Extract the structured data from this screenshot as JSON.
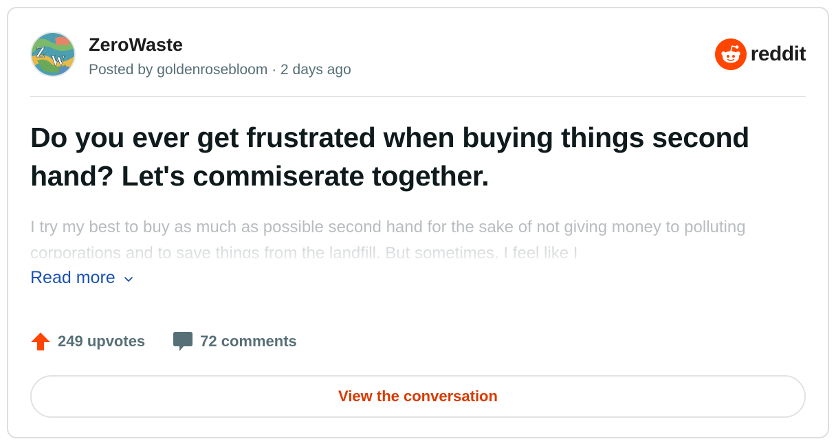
{
  "community": {
    "name": "ZeroWaste",
    "avatar_letters": "ZW",
    "posted_by_prefix": "Posted by",
    "author": "goldenrosebloom",
    "separator": "·",
    "time_ago": "2 days ago"
  },
  "brand": {
    "wordmark": "reddit",
    "icon": "reddit-alien-icon",
    "color": "#ff4500"
  },
  "post": {
    "title": "Do you ever get frustrated when buying things second hand? Let's commiserate together.",
    "body_preview": "I try my best to buy as much as possible second hand for the sake of not giving money to polluting corporations and to save things from the landfill. But sometimes, I feel like I",
    "read_more_label": "Read more"
  },
  "stats": {
    "upvotes": "249 upvotes",
    "upvote_icon": "upvote-arrow-icon",
    "upvote_color": "#ff4500",
    "comments": "72 comments",
    "comment_icon": "comment-bubble-icon"
  },
  "cta": {
    "label": "View the conversation",
    "color": "#d93a00"
  }
}
